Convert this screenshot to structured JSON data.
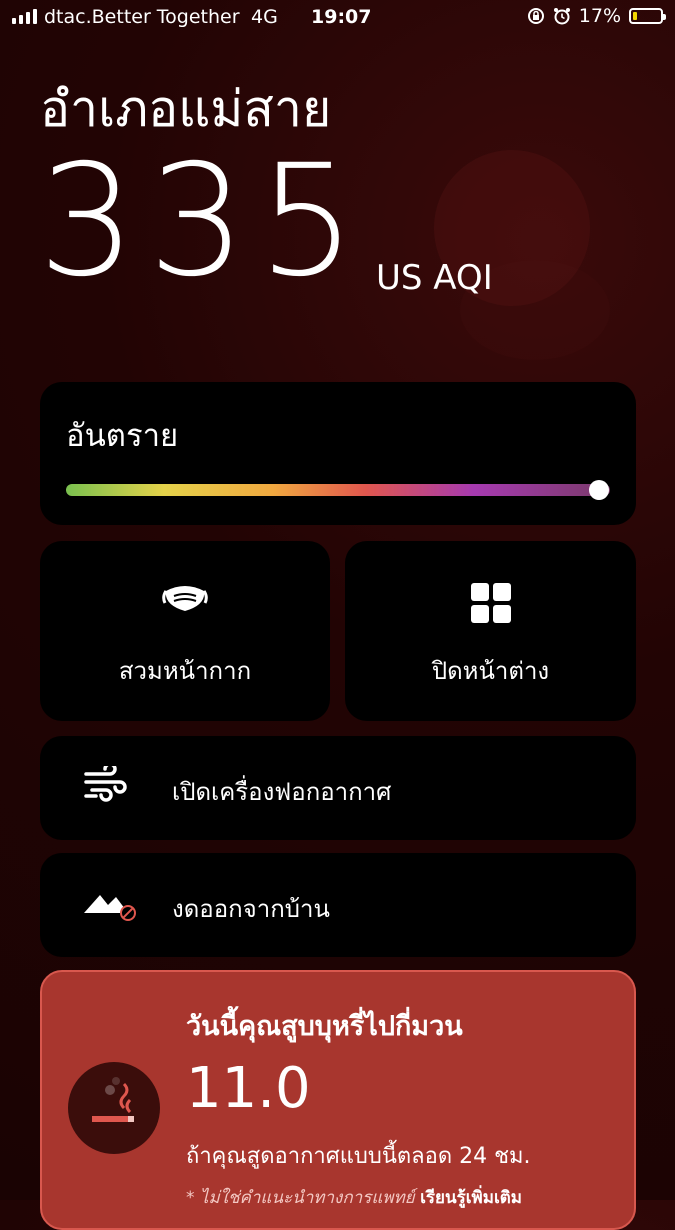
{
  "status_bar": {
    "carrier": "dtac.Better Together",
    "network": "4G",
    "time": "19:07",
    "battery_percent": "17%",
    "battery_level": 0.17
  },
  "location": "อำเภอแม่สาย",
  "aqi": {
    "value": "335",
    "unit": "US AQI",
    "level_label": "อันตราย",
    "scale_position": 0.98
  },
  "tips": {
    "mask": {
      "label": "สวมหน้ากาก",
      "icon": "mask-icon"
    },
    "window": {
      "label": "ปิดหน้าต่าง",
      "icon": "window-icon"
    },
    "purifier": {
      "label": "เปิดเครื่องฟอกอากาศ",
      "icon": "air-purifier-icon"
    },
    "stay_home": {
      "label": "งดออกจากบ้าน",
      "icon": "no-outdoor-icon"
    }
  },
  "cigarette": {
    "title": "วันนี้คุณสูบบุหรี่ไปกี่มวน",
    "value": "11.0",
    "note": "ถ้าคุณสูดอากาศแบบนี้ตลอด 24 ชม.",
    "disclaimer": "* ไม่ใช่คำแนะนำทางการแพทย์",
    "learn_more": "เรียนรู้เพิ่มเติม"
  },
  "colors": {
    "card_background": "#000000",
    "cigarette_card": "#a8362e",
    "battery_fill": "#f2d600"
  }
}
